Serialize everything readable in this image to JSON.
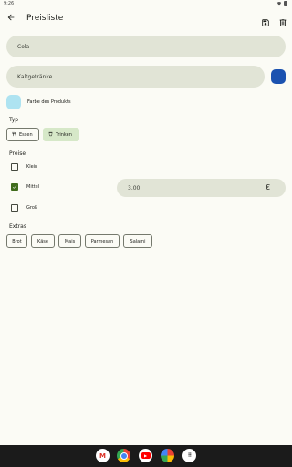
{
  "status_bar": {
    "time": "9:26"
  },
  "app_bar": {
    "title": "Preisliste"
  },
  "form": {
    "name_value": "Cola",
    "category_value": "Kaltgetränke",
    "category_color": "#1b52b0",
    "product_color": "#aee3f1",
    "product_color_label": "Farbe des Produkts"
  },
  "type_section": {
    "label": "Typ",
    "options": [
      {
        "label": "Essen",
        "selected": false
      },
      {
        "label": "Trinken",
        "selected": true
      }
    ]
  },
  "prices_section": {
    "label": "Preise",
    "sizes": [
      {
        "label": "Klein",
        "checked": false
      },
      {
        "label": "Mittel",
        "checked": true,
        "price": "3.00",
        "currency": "€"
      },
      {
        "label": "Groß",
        "checked": false
      }
    ]
  },
  "extras_section": {
    "label": "Extras",
    "items": [
      "Brot",
      "Käse",
      "Mais",
      "Parmesan",
      "Salami"
    ]
  },
  "colors": {
    "accent": "#3f6b1b",
    "selected_chip": "#d6e8c8",
    "field_bg": "#e1e4d6"
  }
}
